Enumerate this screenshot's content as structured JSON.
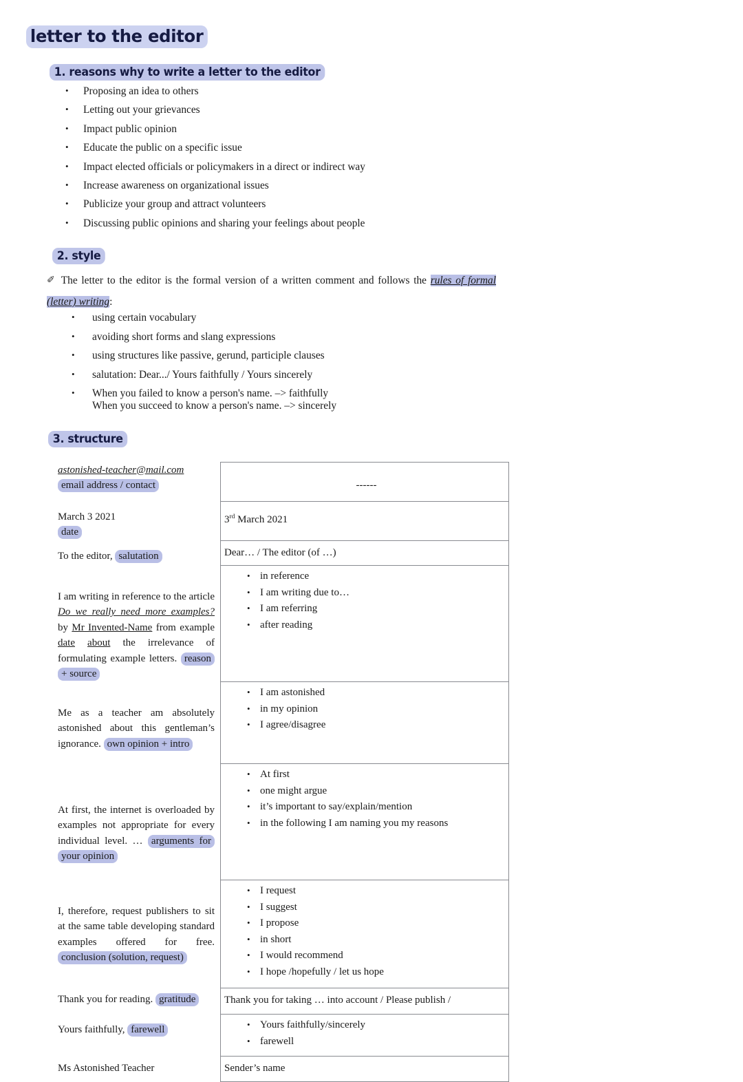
{
  "document": {
    "title": "letter to the editor"
  },
  "sections": {
    "reasons": {
      "heading": "1. reasons why to write a letter to the editor",
      "items": [
        "Proposing an idea to others",
        "Letting out your grievances",
        "Impact public opinion",
        "Educate the public on a specific issue",
        "Impact elected officials or policymakers in a direct or indirect way",
        "Increase awareness on organizational issues",
        "Publicize your group and attract volunteers",
        "Discussing public opinions and sharing your feelings about people"
      ]
    },
    "style": {
      "heading": "2. style",
      "intro_before": "The letter to the editor is the formal version of a written comment and follows the ",
      "intro_highlight": "rules of formal (letter) writing",
      "intro_after": ":",
      "items": [
        "using certain vocabulary",
        "avoiding short forms and slang expressions",
        "using structures like passive, gerund, participle clauses",
        "salutation: Dear.../ Yours faithfully / Yours sincerely"
      ],
      "last_item_line1": "When you failed to know a person's name. –> faithfully",
      "last_item_line2": "When you succeed to know a person's name. –> sincerely"
    },
    "structure": {
      "heading": "3. structure",
      "rows": {
        "contact": {
          "left_text": "astonished-teacher@mail.com",
          "left_label": "email address / contact",
          "right_dashes": "------"
        },
        "date": {
          "left_text": "March 3 2021",
          "left_label": "date",
          "right_text_sup": "3",
          "right_text_sup_ord": "rd",
          "right_text_rest": " March 2021"
        },
        "salutation": {
          "left_text": "To the editor, ",
          "left_label": "salutation",
          "right_text": "Dear… / The editor (of …)"
        },
        "reason": {
          "left_p1": "I am writing in reference to the article ",
          "left_title": "Do we really need more examples?",
          "left_p2": " by ",
          "left_name": "Mr Invented-Name",
          "left_p3": " from example ",
          "left_date": "date",
          "left_p4": " ",
          "left_about": "about",
          "left_p5": " the irrelevance of formulating example letters. ",
          "left_label": "reason + source",
          "right_items": [
            "in reference",
            "I am writing due to…",
            "I am referring",
            "after reading"
          ]
        },
        "opinion": {
          "left_text": "Me as a teacher am absolutely astonished about this gentleman’s ignorance. ",
          "left_label": "own opinion + intro",
          "right_items": [
            "I am astonished",
            "in my opinion",
            "I agree/disagree"
          ]
        },
        "arguments": {
          "left_text": "At first, the internet is overloaded by examples not appropriate for every individual level. …",
          "left_label": "arguments for your opinion",
          "right_items": [
            "At first",
            "one might argue",
            "it’s important to say/explain/mention",
            "in the following I am naming you my reasons"
          ]
        },
        "conclusion": {
          "left_text": "I, therefore, request publishers to sit at the same table developing standard examples offered for free. ",
          "left_label": "conclusion (solution, request)",
          "right_items": [
            "I request",
            "I suggest",
            "I propose",
            "in short",
            "I would recommend",
            "I hope /hopefully / let us hope"
          ]
        },
        "gratitude": {
          "left_text": "Thank you for reading. ",
          "left_label": "gratitude",
          "right_text": "Thank you for taking … into account / Please publish /"
        },
        "farewell": {
          "left_text": "Yours faithfully, ",
          "left_label": "farewell",
          "right_items": [
            "Yours faithfully/sincerely",
            "farewell"
          ]
        },
        "sender": {
          "left_text": "Ms Astonished Teacher",
          "right_text": "Sender’s name"
        }
      }
    }
  },
  "colors": {
    "highlight_strong": "#b9bfe6",
    "highlight_light": "#ccd2f0",
    "heading_text": "#161b42",
    "table_border": "#888a90"
  },
  "icons": {
    "quill": "✐"
  }
}
